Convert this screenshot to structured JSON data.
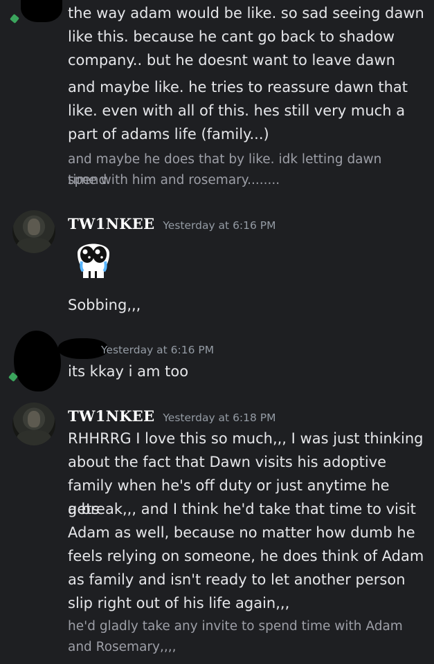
{
  "messages": [
    {
      "id": "m1",
      "lines": [
        "the way adam would be like. so sad seeing dawn",
        "like this. because he cant go back to shadow",
        "company.. but he doesnt want to leave dawn"
      ],
      "lines2": [
        "and maybe like. he tries to reassure dawn that",
        "like. even with all of this. hes still very much a",
        "part of adams life (family...)"
      ],
      "sub_lines": [
        "and maybe he does that by like. idk letting dawn spend",
        "time with him and rosemary........"
      ]
    },
    {
      "id": "m2",
      "username": "TW1NKEE",
      "timestamp": "Yesterday at 6:16 PM",
      "sticker": "crying-skull-sticker",
      "text": "Sobbing,,,"
    },
    {
      "id": "m3",
      "timestamp": "Yesterday at 6:16 PM",
      "text": "its kkay i am too"
    },
    {
      "id": "m4",
      "username": "TW1NKEE",
      "timestamp": "Yesterday at 6:18 PM",
      "lines": [
        "RHHRRG I love this so much,,, I was just thinking",
        "about the fact that Dawn visits his adoptive",
        "family when he's off duty or just anytime he gets",
        "a break,,, and I think he'd take that time to visit",
        "Adam as well, because no matter how dumb he",
        "feels relying on someone, he does think of Adam",
        "as family and isn't ready to let another person",
        "slip right out of his life again,,,"
      ],
      "sub_lines": [
        "he'd gladly take any invite to spend time with Adam",
        "and Rosemary,,,,"
      ]
    }
  ],
  "colors": {
    "background": "#1e1f22",
    "text": "#e6e7ea",
    "subtext": "#9d9fa7",
    "username": "#ffffff",
    "timestamp": "#949ba4"
  }
}
